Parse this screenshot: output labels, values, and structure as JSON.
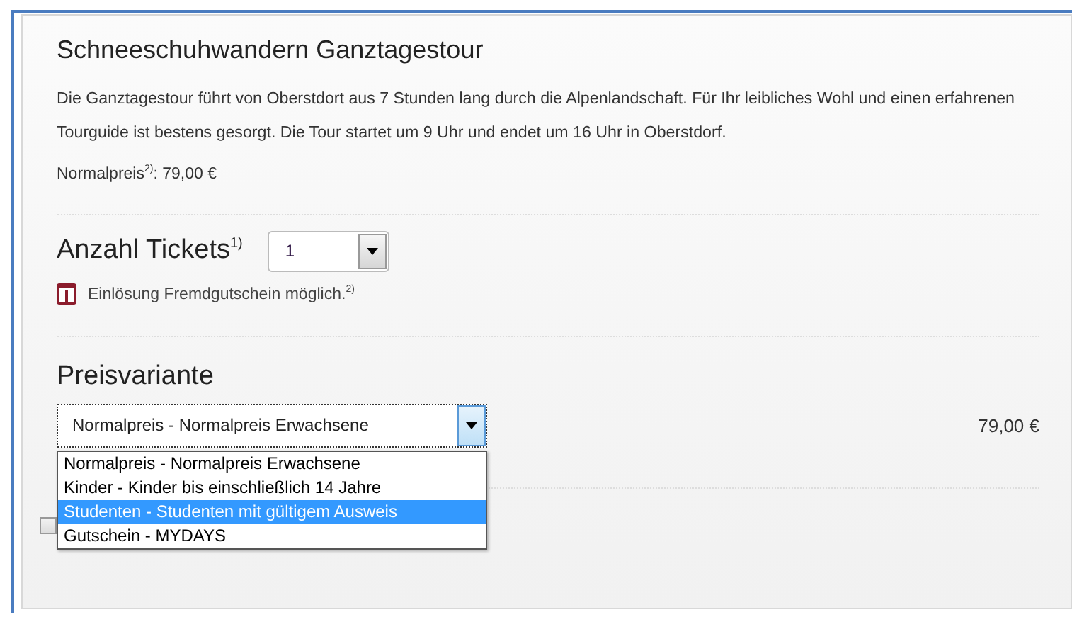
{
  "title": "Schneeschuhwandern Ganztagestour",
  "description": "Die Ganztagestour führt von Oberstdort aus 7 Stunden lang durch die Alpenlandschaft. Für Ihr leibliches Wohl und einen erfahrenen Tourguide ist bestens gesorgt. Die Tour startet um 9 Uhr und endet um 16 Uhr in Oberstdorf.",
  "normal_price": "Normalpreis$^{2)}$: 79,00 €",
  "tickets": {
    "label": "Anzahl Tickets$^{1)}$",
    "value": "1",
    "note": "Einlösung Fremdgutschein möglich.$^{2)}$"
  },
  "price_variant": {
    "label": "Preisvariante",
    "value": "Normalpreis - Normalpreis Erwachsene",
    "price": "79,00 €",
    "expanded": true,
    "options": [
      {
        "label": "Normalpreis - Normalpreis Erwachsene",
        "highlighted": false
      },
      {
        "label": "Kinder - Kinder bis einschließlich 14 Jahre",
        "highlighted": false
      },
      {
        "label": "Studenten - Studenten mit gültigem Ausweis",
        "highlighted": true
      },
      {
        "label": "Gutschein - MYDAYS",
        "highlighted": false
      }
    ]
  },
  "checkbox": {
    "checked": false
  }
}
